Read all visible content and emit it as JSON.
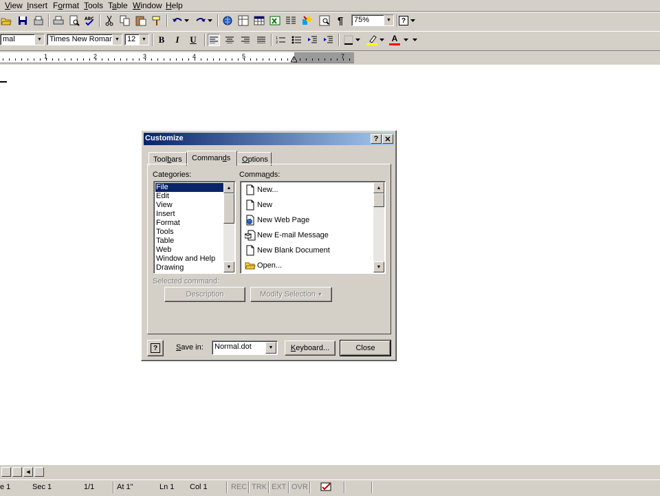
{
  "menubar": {
    "items": [
      {
        "pre": "",
        "ul": "V",
        "post": "iew"
      },
      {
        "pre": "",
        "ul": "I",
        "post": "nsert"
      },
      {
        "pre": "F",
        "ul": "o",
        "post": "rmat"
      },
      {
        "pre": "",
        "ul": "T",
        "post": "ools"
      },
      {
        "pre": "T",
        "ul": "a",
        "post": "ble"
      },
      {
        "pre": "",
        "ul": "W",
        "post": "indow"
      },
      {
        "pre": "",
        "ul": "H",
        "post": "elp"
      }
    ]
  },
  "toolbar": {
    "zoom": "75%",
    "style": "mal",
    "font": "Times New Roman",
    "size": "12",
    "bold": "B",
    "italic": "I",
    "underline": "U",
    "pilcrow": "¶",
    "help": "?",
    "font_color_letter": "A",
    "highlight_color": "#ffff00",
    "font_color": "#ff0000"
  },
  "ruler": {
    "numbers": [
      "1",
      "2",
      "3",
      "4",
      "5",
      "7"
    ]
  },
  "dialog": {
    "title": "Customize",
    "help_btn": "?",
    "close_btn": "✕",
    "tabs": {
      "toolbars": {
        "pre": "Tool",
        "ul": "b",
        "post": "ars"
      },
      "commands": {
        "pre": "Comman",
        "ul": "d",
        "post": "s"
      },
      "options": {
        "pre": "",
        "ul": "O",
        "post": "ptions"
      }
    },
    "categories_label": {
      "pre": "Cate",
      "ul": "g",
      "post": "ories:"
    },
    "commands_label": {
      "pre": "Comma",
      "ul": "n",
      "post": "ds:"
    },
    "categories": [
      "File",
      "Edit",
      "View",
      "Insert",
      "Format",
      "Tools",
      "Table",
      "Web",
      "Window and Help",
      "Drawing"
    ],
    "selected_category": "File",
    "commands": [
      {
        "label": "New...",
        "icon": "new-document-icon"
      },
      {
        "label": "New",
        "icon": "new-document-icon"
      },
      {
        "label": "New Web Page",
        "icon": "web-page-icon"
      },
      {
        "label": "New E-mail Message",
        "icon": "email-message-icon"
      },
      {
        "label": "New Blank Document",
        "icon": "new-document-icon"
      },
      {
        "label": "Open...",
        "icon": "open-folder-icon"
      }
    ],
    "selected_command_label": "Selected command:",
    "description_btn": "Description",
    "modify_selection_btn": "Modify Selection",
    "save_in_label": {
      "pre": "",
      "ul": "S",
      "post": "ave in:"
    },
    "save_in_value": "Normal.dot",
    "keyboard_btn": {
      "pre": "",
      "ul": "K",
      "post": "eyboard..."
    },
    "close_button": "Close"
  },
  "status": {
    "page": "e 1",
    "sec": "Sec  1",
    "pages": "1/1",
    "at": "At  1\"",
    "ln": "Ln  1",
    "col": "Col  1",
    "rec": "REC",
    "trk": "TRK",
    "ext": "EXT",
    "ovr": "OVR"
  }
}
